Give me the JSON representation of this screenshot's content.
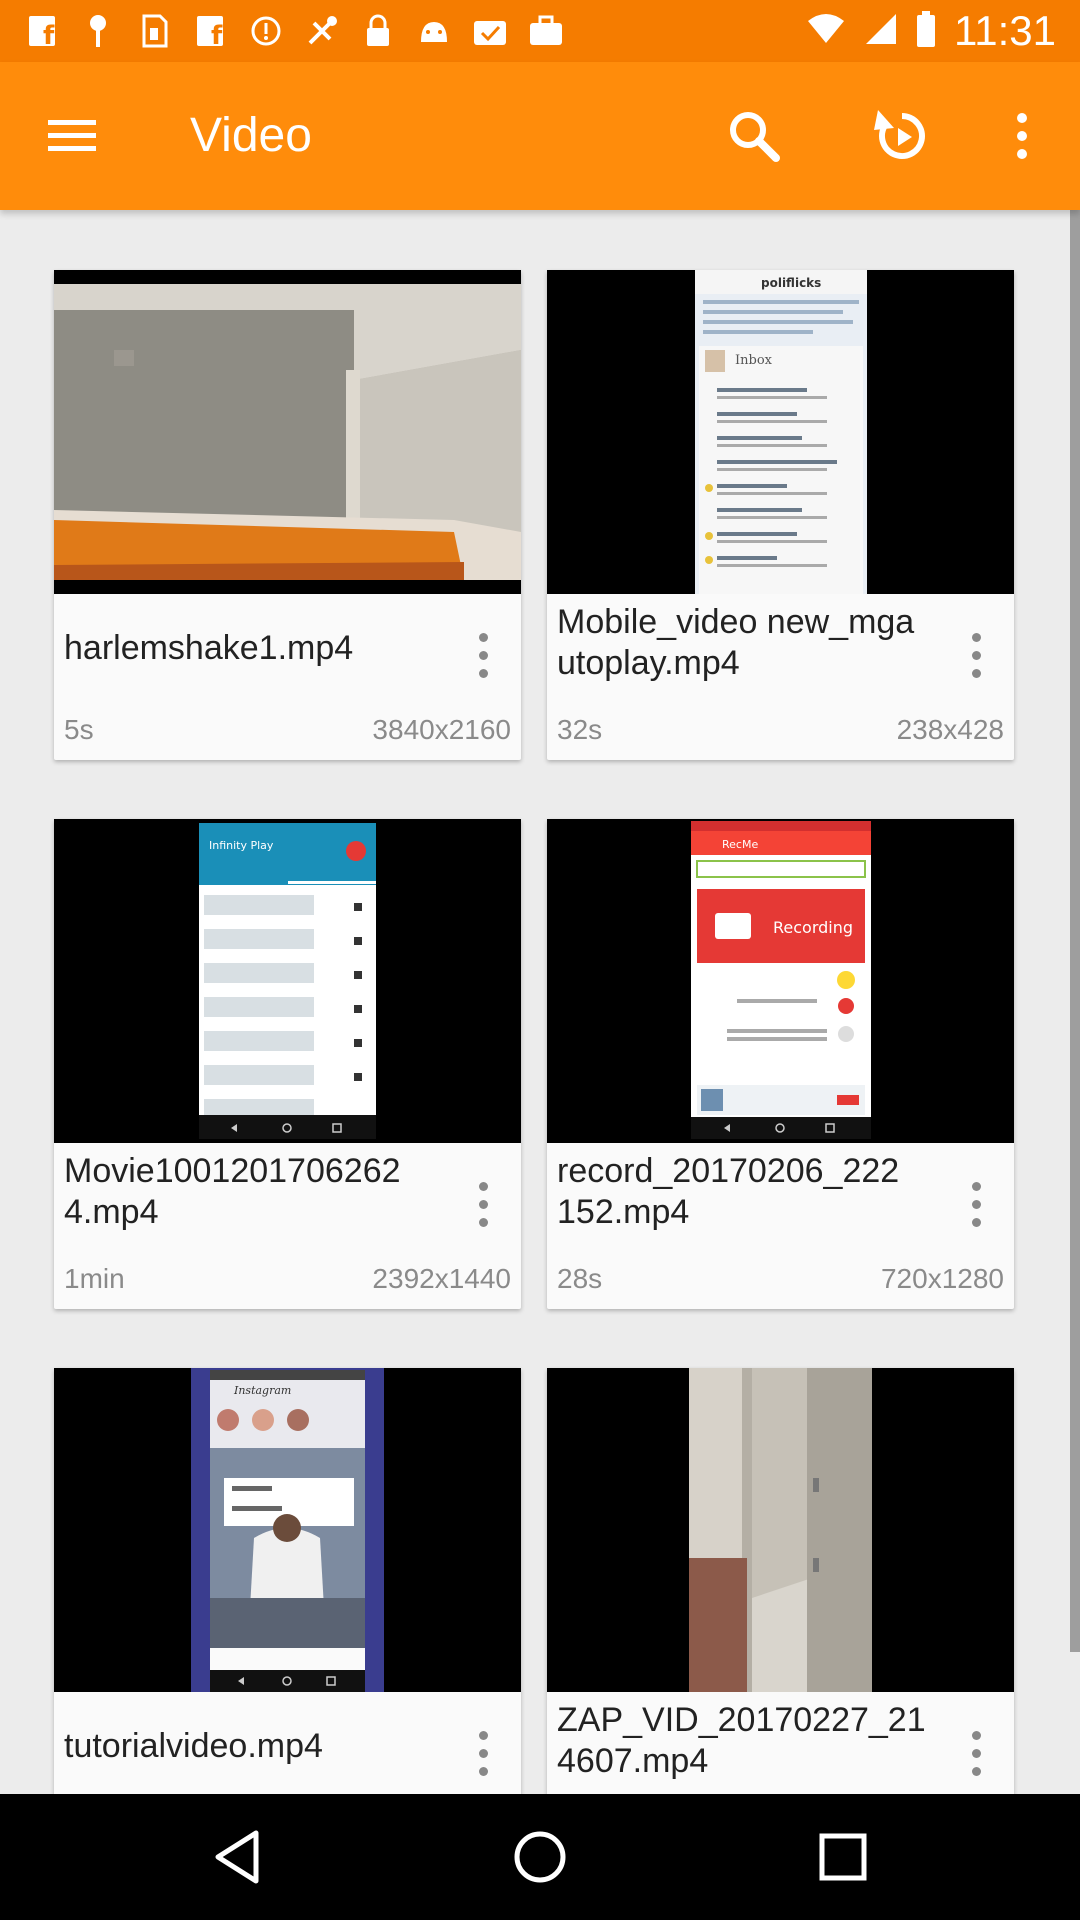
{
  "status_bar": {
    "time": "11:31",
    "icons": [
      "facebook-icon",
      "pin-icon",
      "sim-icon",
      "facebook-icon",
      "info-icon",
      "fake-gps-icon",
      "lock-icon",
      "android-icon",
      "task-icon",
      "briefcase-icon",
      "wifi-icon",
      "signal-icon",
      "battery-icon"
    ]
  },
  "app_bar": {
    "title": "Video",
    "menu_icon": "hamburger-menu-icon",
    "search_icon": "search-icon",
    "refresh_icon": "refresh-icon",
    "more_icon": "more-vert-icon"
  },
  "videos": [
    {
      "title": "harlemshake1.mp4",
      "duration": "5s",
      "resolution": "3840x2160",
      "thumb": "room-corner"
    },
    {
      "title": "Mobile_video new_mgautoplay.mp4",
      "duration": "32s",
      "resolution": "238x428",
      "thumb": "email-inbox"
    },
    {
      "title": "Movie1001201706262 4.mp4",
      "duration": "1min",
      "resolution": "2392x1440",
      "thumb": "infinity-play-app"
    },
    {
      "title": "record_20170206_222 152.mp4",
      "duration": "28s",
      "resolution": "720x1280",
      "thumb": "recording-app"
    },
    {
      "title": "tutorialvideo.mp4",
      "duration": "",
      "resolution": "",
      "thumb": "instagram-app"
    },
    {
      "title": "ZAP_VID_20170227_21 4607.mp4",
      "duration": "",
      "resolution": "",
      "thumb": "hallway"
    }
  ],
  "thumb_text": {
    "poliflicks": "poliflicks",
    "inbox": "Inbox",
    "infinity_play": "Infinity Play",
    "recme": "RecMe",
    "recording": "Recording",
    "instagram": "Instagram"
  },
  "nav_bar": {
    "back_icon": "back-triangle-icon",
    "home_icon": "home-circle-icon",
    "recents_icon": "recents-square-icon"
  },
  "colors": {
    "status_bar": "#f57c00",
    "app_bar": "#ff8c0b",
    "background": "#ececec",
    "card": "#fafafa"
  }
}
